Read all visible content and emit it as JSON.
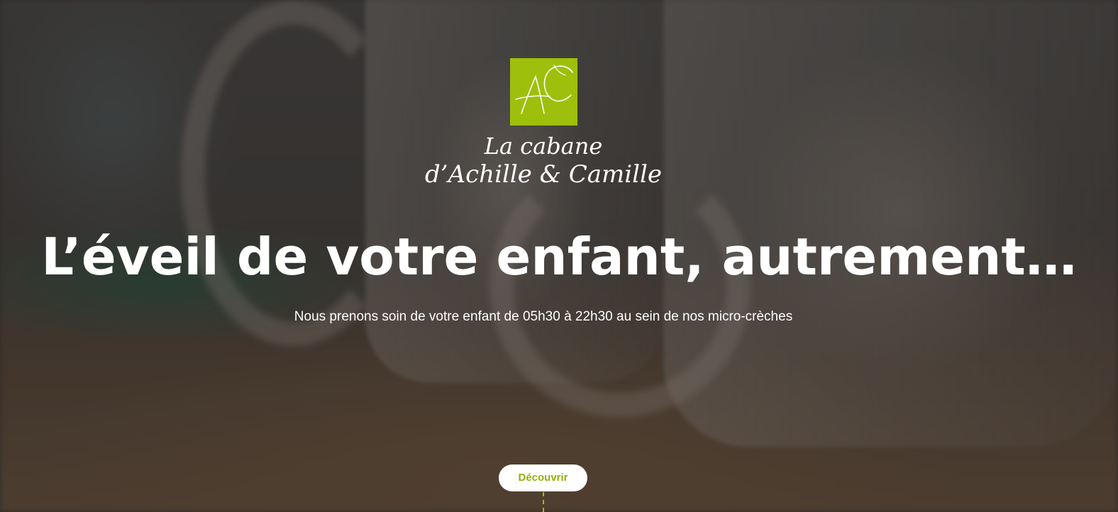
{
  "hero": {
    "logo": {
      "monogram": "AC",
      "line1": "La cabane",
      "line2": "d’Achille & Camille",
      "brand_color": "#9ebf0b"
    },
    "headline": "L’éveil de votre enfant, autrement…",
    "subtitle": "Nous prenons soin de votre enfant de 05h30 à 22h30 au sein de nos micro-crèches",
    "cta_label": "Découvrir",
    "cta_text_color": "#8fb20a"
  }
}
